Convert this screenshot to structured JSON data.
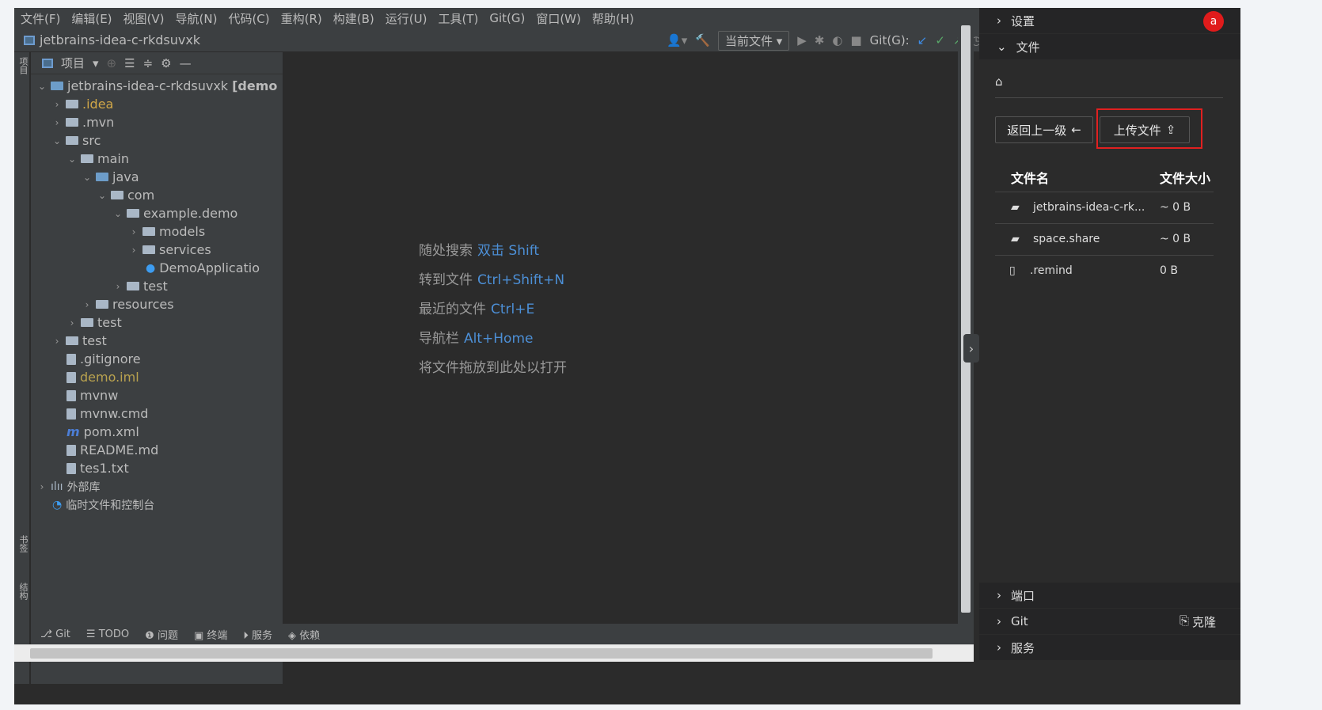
{
  "menu": [
    "文件(F)",
    "编辑(E)",
    "视图(V)",
    "导航(N)",
    "代码(C)",
    "重构(R)",
    "构建(B)",
    "运行(U)",
    "工具(T)",
    "Git(G)",
    "窗口(W)",
    "帮助(H)"
  ],
  "project_title": "jetbrains-idea-c-rkdsuvxk",
  "toolbar": {
    "run_config": "当前文件 ▾",
    "git_label": "Git(G):"
  },
  "project_panel": {
    "label": "项目"
  },
  "tree": [
    {
      "label": "jetbrains-idea-c-rkdsuvxk",
      "suffix": "[demo",
      "chev": "⌄"
    },
    {
      "label": ".idea",
      "chev": "›"
    },
    {
      "label": ".mvn",
      "chev": "›"
    },
    {
      "label": "src",
      "chev": "⌄"
    },
    {
      "label": "main",
      "chev": "⌄"
    },
    {
      "label": "java",
      "chev": "⌄"
    },
    {
      "label": "com",
      "chev": "⌄"
    },
    {
      "label": "example.demo",
      "chev": "⌄"
    },
    {
      "label": "models",
      "chev": "›"
    },
    {
      "label": "services",
      "chev": "›"
    },
    {
      "label": "DemoApplicatio",
      "chev": ""
    },
    {
      "label": "test",
      "chev": "›"
    },
    {
      "label": "resources",
      "chev": "›"
    },
    {
      "label": "test",
      "chev": "›"
    },
    {
      "label": "test",
      "chev": "›"
    },
    {
      "label": ".gitignore",
      "chev": ""
    },
    {
      "label": "demo.iml",
      "chev": ""
    },
    {
      "label": "mvnw",
      "chev": ""
    },
    {
      "label": "mvnw.cmd",
      "chev": ""
    },
    {
      "label": "pom.xml",
      "chev": ""
    },
    {
      "label": "README.md",
      "chev": ""
    },
    {
      "label": "tes1.txt",
      "chev": ""
    },
    {
      "label": "外部库",
      "chev": "›"
    },
    {
      "label": "临时文件和控制台",
      "chev": ""
    }
  ],
  "hints": [
    {
      "text": "随处搜索",
      "key": "双击 Shift"
    },
    {
      "text": "转到文件",
      "key": "Ctrl+Shift+N"
    },
    {
      "text": "最近的文件",
      "key": "Ctrl+E"
    },
    {
      "text": "导航栏",
      "key": "Alt+Home"
    },
    {
      "text": "将文件拖放到此处以打开",
      "key": ""
    }
  ],
  "bottom_tabs": [
    "Git",
    "TODO",
    "问题",
    "终端",
    "服务",
    "依赖"
  ],
  "left_strip": {
    "bookmarks": "书签",
    "structure": "结构"
  },
  "right_panel": {
    "avatar": "a",
    "sections": {
      "settings": "设置",
      "files": "文件",
      "ports": "端口",
      "git": "Git",
      "services": "服务"
    },
    "clone_label": "克隆",
    "back_button": "返回上一级",
    "upload_button": "上传文件",
    "col_name": "文件名",
    "col_size": "文件大小",
    "files": [
      {
        "name": "jetbrains-idea-c-rk...",
        "size": "~ 0 B",
        "type": "folder"
      },
      {
        "name": "space.share",
        "size": "~ 0 B",
        "type": "folder"
      },
      {
        "name": ".remind",
        "size": "0 B",
        "type": "file"
      }
    ]
  }
}
